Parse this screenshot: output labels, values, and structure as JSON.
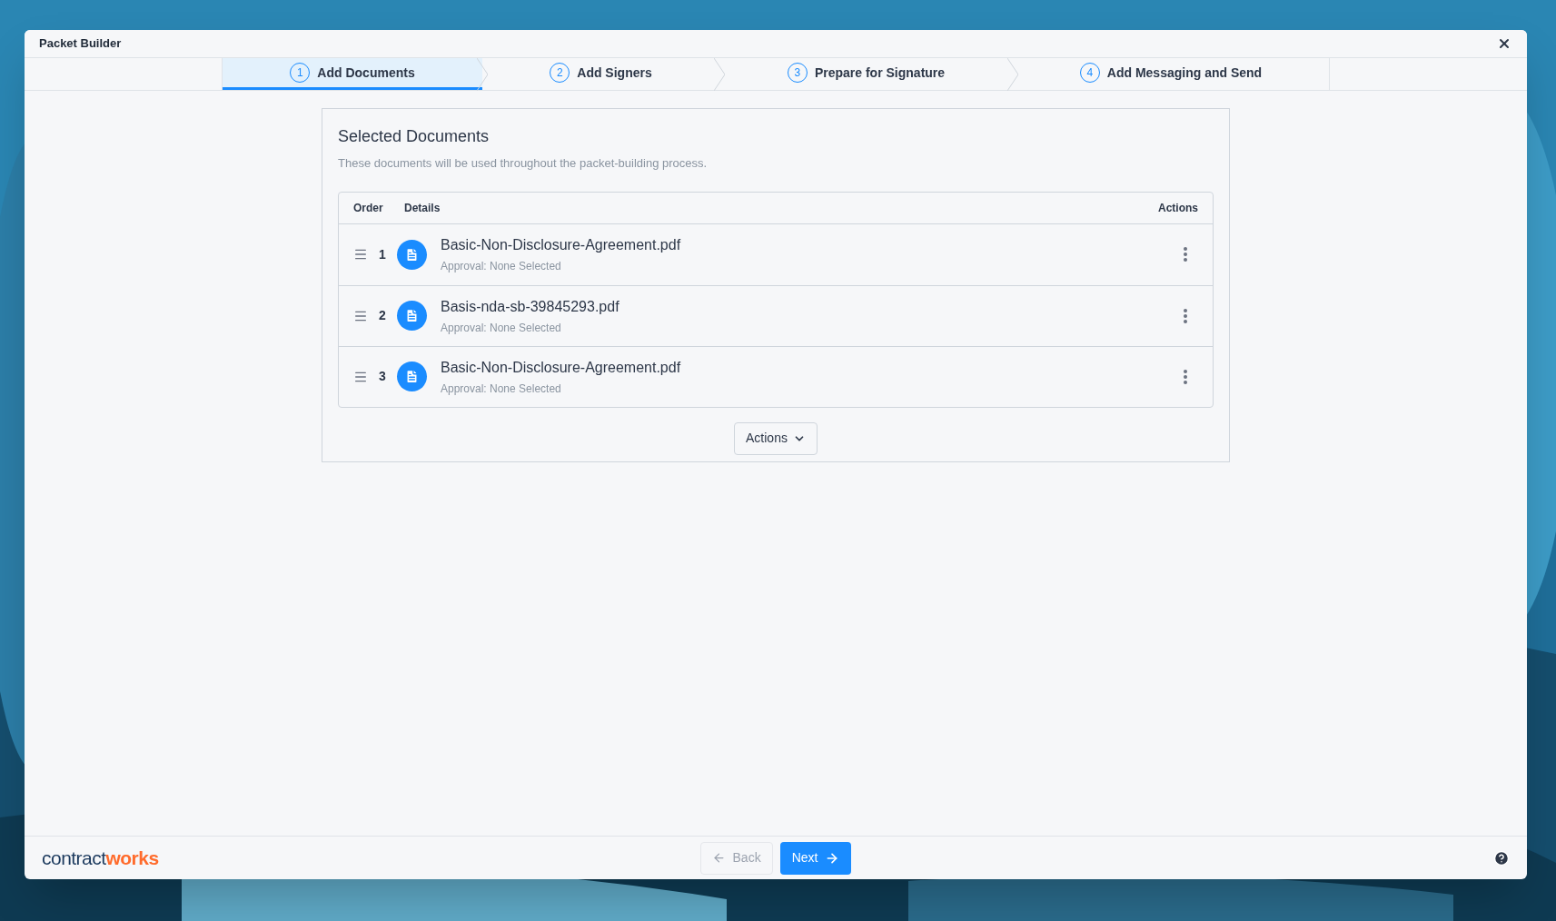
{
  "window": {
    "title": "Packet Builder"
  },
  "steps": [
    {
      "number": "1",
      "label": "Add Documents",
      "selected": true
    },
    {
      "number": "2",
      "label": "Add Signers",
      "selected": false
    },
    {
      "number": "3",
      "label": "Prepare for Signature",
      "selected": false
    },
    {
      "number": "4",
      "label": "Add Messaging and Send",
      "selected": false
    }
  ],
  "card": {
    "title": "Selected Documents",
    "description": "These documents will be used throughout the packet-building process."
  },
  "table": {
    "columns": [
      "Order",
      "Details",
      "Actions"
    ],
    "rows": [
      {
        "order": "1",
        "name": "Basic-Non-Disclosure-Agreement.pdf",
        "approval": "Approval: None Selected"
      },
      {
        "order": "2",
        "name": "Basis-nda-sb-39845293.pdf",
        "approval": "Approval: None Selected"
      },
      {
        "order": "3",
        "name": "Basic-Non-Disclosure-Agreement.pdf",
        "approval": "Approval: None Selected"
      }
    ]
  },
  "actions_button": "Actions",
  "footer": {
    "logo": {
      "part_1": "contract",
      "part_2": "works"
    },
    "back": {
      "label": "Back",
      "disabled": true
    },
    "next": {
      "label": "Next",
      "disabled": false
    }
  }
}
